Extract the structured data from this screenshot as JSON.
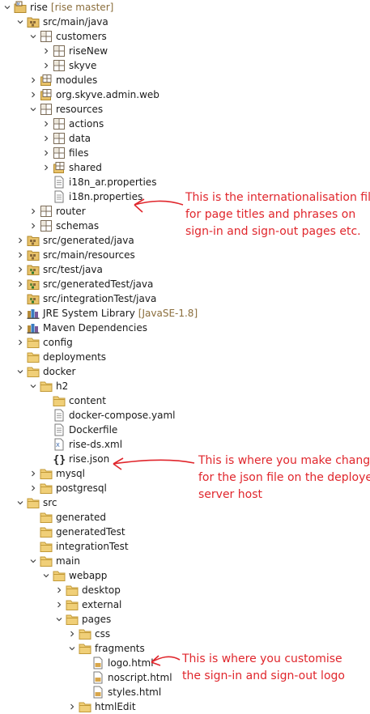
{
  "tree": [
    {
      "label": "rise",
      "decoration": "[rise master]",
      "icon": "project",
      "twisty": "expanded",
      "depth": 0
    },
    {
      "label": "src/main/java",
      "icon": "srcfolder",
      "twisty": "expanded",
      "depth": 1
    },
    {
      "label": "customers",
      "icon": "package",
      "twisty": "expanded",
      "depth": 2
    },
    {
      "label": "riseNew",
      "icon": "package",
      "twisty": "collapsed",
      "depth": 3
    },
    {
      "label": "skyve",
      "icon": "package",
      "twisty": "collapsed",
      "depth": 3
    },
    {
      "label": "modules",
      "icon": "package-res",
      "twisty": "collapsed",
      "depth": 2
    },
    {
      "label": "org.skyve.admin.web",
      "icon": "package-res",
      "twisty": "collapsed",
      "depth": 2
    },
    {
      "label": "resources",
      "icon": "package",
      "twisty": "expanded",
      "depth": 2
    },
    {
      "label": "actions",
      "icon": "package",
      "twisty": "collapsed",
      "depth": 3
    },
    {
      "label": "data",
      "icon": "package",
      "twisty": "collapsed",
      "depth": 3
    },
    {
      "label": "files",
      "icon": "package",
      "twisty": "collapsed",
      "depth": 3
    },
    {
      "label": "shared",
      "icon": "package-res",
      "twisty": "collapsed",
      "depth": 3
    },
    {
      "label": "i18n_ar.properties",
      "icon": "file",
      "twisty": "none",
      "depth": 3
    },
    {
      "label": "i18n.properties",
      "icon": "file",
      "twisty": "none",
      "depth": 3
    },
    {
      "label": "router",
      "icon": "package",
      "twisty": "collapsed",
      "depth": 2
    },
    {
      "label": "schemas",
      "icon": "package",
      "twisty": "collapsed",
      "depth": 2
    },
    {
      "label": "src/generated/java",
      "icon": "srcfolder",
      "twisty": "collapsed",
      "depth": 1
    },
    {
      "label": "src/main/resources",
      "icon": "srcfolder",
      "twisty": "collapsed",
      "depth": 1
    },
    {
      "label": "src/test/java",
      "icon": "srcfolder-test",
      "twisty": "collapsed",
      "depth": 1
    },
    {
      "label": "src/generatedTest/java",
      "icon": "srcfolder-test",
      "twisty": "collapsed",
      "depth": 1
    },
    {
      "label": "src/integrationTest/java",
      "icon": "srcfolder-test",
      "twisty": "none",
      "depth": 1
    },
    {
      "label": "JRE System Library",
      "decoration": "[JavaSE-1.8]",
      "icon": "library",
      "twisty": "collapsed",
      "depth": 1
    },
    {
      "label": "Maven Dependencies",
      "icon": "library",
      "twisty": "collapsed",
      "depth": 1
    },
    {
      "label": "config",
      "icon": "folder",
      "twisty": "collapsed",
      "depth": 1
    },
    {
      "label": "deployments",
      "icon": "folder",
      "twisty": "none",
      "depth": 1
    },
    {
      "label": "docker",
      "icon": "folder",
      "twisty": "expanded",
      "depth": 1
    },
    {
      "label": "h2",
      "icon": "folder",
      "twisty": "expanded",
      "depth": 2
    },
    {
      "label": "content",
      "icon": "folder",
      "twisty": "none",
      "depth": 3
    },
    {
      "label": "docker-compose.yaml",
      "icon": "file",
      "twisty": "none",
      "depth": 3
    },
    {
      "label": "Dockerfile",
      "icon": "file",
      "twisty": "none",
      "depth": 3
    },
    {
      "label": "rise-ds.xml",
      "icon": "xmlfile",
      "twisty": "none",
      "depth": 3
    },
    {
      "label": "rise.json",
      "icon": "jsonfile",
      "twisty": "none",
      "depth": 3
    },
    {
      "label": "mysql",
      "icon": "folder",
      "twisty": "collapsed",
      "depth": 2
    },
    {
      "label": "postgresql",
      "icon": "folder",
      "twisty": "collapsed",
      "depth": 2
    },
    {
      "label": "src",
      "icon": "folder",
      "twisty": "expanded",
      "depth": 1
    },
    {
      "label": "generated",
      "icon": "folder",
      "twisty": "none",
      "depth": 2
    },
    {
      "label": "generatedTest",
      "icon": "folder",
      "twisty": "none",
      "depth": 2
    },
    {
      "label": "integrationTest",
      "icon": "folder",
      "twisty": "none",
      "depth": 2
    },
    {
      "label": "main",
      "icon": "folder",
      "twisty": "expanded",
      "depth": 2
    },
    {
      "label": "webapp",
      "icon": "folder",
      "twisty": "expanded",
      "depth": 3
    },
    {
      "label": "desktop",
      "icon": "folder",
      "twisty": "collapsed",
      "depth": 4
    },
    {
      "label": "external",
      "icon": "folder",
      "twisty": "collapsed",
      "depth": 4
    },
    {
      "label": "pages",
      "icon": "folder",
      "twisty": "expanded",
      "depth": 4
    },
    {
      "label": "css",
      "icon": "folder",
      "twisty": "collapsed",
      "depth": 5
    },
    {
      "label": "fragments",
      "icon": "folder",
      "twisty": "expanded",
      "depth": 5
    },
    {
      "label": "logo.html",
      "icon": "htmlfile",
      "twisty": "none",
      "depth": 6
    },
    {
      "label": "noscript.html",
      "icon": "htmlfile",
      "twisty": "none",
      "depth": 6
    },
    {
      "label": "styles.html",
      "icon": "htmlfile",
      "twisty": "none",
      "depth": 6
    },
    {
      "label": "htmlEdit",
      "icon": "folder",
      "twisty": "collapsed",
      "depth": 5
    }
  ],
  "annotations": {
    "i18n": {
      "line1": "This is the internationalisation file",
      "line2": "for page titles and phrases on",
      "line3": "sign-in and sign-out pages etc."
    },
    "json": {
      "line1": "This is where you make changes",
      "line2": "for the json file on the deployed",
      "line3": "server host"
    },
    "logo": {
      "line1": "This is where you customise",
      "line2": "the sign-in and sign-out logo"
    }
  },
  "colors": {
    "annotation": "#e0262c",
    "decoration": "#8a6d3b",
    "folder": "#e8c26a",
    "package": "#8a6a3a"
  }
}
